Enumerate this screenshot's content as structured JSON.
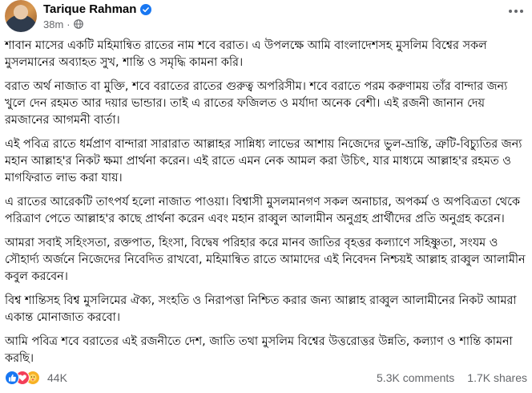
{
  "author": {
    "name": "Tarique Rahman",
    "time": "38m",
    "separator": "·"
  },
  "post": {
    "paragraphs": [
      "শাবান মাসের একটি মহিমান্বিত রাতের নাম শবে বরাত। এ উপলক্ষে আমি বাংলাদেশসহ মুসলিম বিশ্বের সকল মুসলমানের অব্যাহত সুখ, শান্তি ও সমৃদ্ধি কামনা করি।",
      "বরাত অর্থ নাজাত বা মুক্তি, শবে বরাতের রাতের গুরুত্ব অপরিসীম। শবে বরাতে পরম করুণাময় তাঁর বান্দার জন্য খুলে দেন রহমত আর দয়ার ভান্ডার। তাই এ রাতের ফজিলত ও মর্যাদা অনেক বেশী। এই রজনী জানান দেয় রমজানের আগমনী বার্তা।",
      "এই পবিত্র রাতে ধর্মপ্রাণ বান্দারা সারারাত আল্লাহর সান্নিধ্য লাভের আশায় নিজেদের ভুল-ভ্রান্তি, ত্রুটি-বিচ্যুতির জন্য মহান আল্লাহ'র নিকট ক্ষমা প্রার্থনা করেন। এই রাতে এমন নেক আমল করা উচিৎ, যার মাধ্যমে আল্লাহ'র রহমত ও মাগফিরাত লাভ করা যায়।",
      "এ রাতের আরেকটি তাৎপর্য হলো নাজাত পাওয়া। বিশ্বাসী মুসলমানগণ সকল অনাচার, অপকর্ম ও অপবিত্রতা থেকে পরিত্রাণ পেতে আল্লাহ'র কাছে প্রার্থনা করেন এবং মহান রাব্বুল আলামীন অনুগ্রহ প্রার্থীদের প্রতি অনুগ্রহ করেন।",
      "আমরা সবাই সহিংসতা, রক্তপাত, হিংসা, বিদ্বেষ পরিহার করে মানব জাতির বৃহত্তর কল্যাণে সহিষ্ণুতা, সংযম ও সৌহার্দ্য অর্জনে নিজেদের নিবেদিত রাখবো, মহিমান্বিত রাতে আমাদের এই নিবেদন নিশ্চয়ই আল্লাহ রাব্বুল আলামীন কবুল করবেন।",
      "বিশ্ব শান্তিসহ বিশ্ব মুসলিমের ঐক্য, সংহতি ও নিরাপত্তা নিশ্চিত করার জন্য আল্লাহ রাব্বুল আলামীনের নিকট আমরা একান্ত মোনাজাত করবো।",
      "আমি পবিত্র শবে বরাতের এই রজনীতে দেশ, জাতি তথা মুসলিম বিশ্বের উত্তরোত্তর উন্নতি, কল্যাণ ও শান্তি কামনা করছি।"
    ]
  },
  "reactions": {
    "icons": [
      "like-icon",
      "love-icon",
      "care-icon"
    ],
    "count": "44K"
  },
  "stats": {
    "comments": "5.3K comments",
    "shares": "1.7K shares"
  },
  "colors": {
    "verified": "#1877f2",
    "like": "#1877f2",
    "love": "#f33e58",
    "care": "#f7b125",
    "secondary_text": "#65676b"
  }
}
